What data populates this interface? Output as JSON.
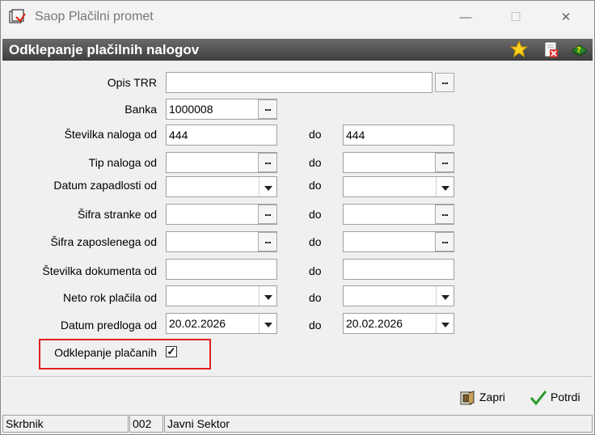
{
  "window": {
    "title": "Saop Plačilni promet",
    "minimize": "—",
    "maximize": "☐",
    "close": "✕"
  },
  "header": {
    "title": "Odklepanje plačilnih nalogov",
    "icons": [
      "star-icon",
      "delete-document-icon",
      "help-book-icon"
    ]
  },
  "form": {
    "opis_trr": {
      "label": "Opis TRR",
      "value": ""
    },
    "banka": {
      "label": "Banka",
      "value": "1000008"
    },
    "stevilka_naloga": {
      "label": "Številka naloga od",
      "from": "444",
      "to_label": "do",
      "to": "444"
    },
    "tip_naloga": {
      "label": "Tip naloga od",
      "from": "",
      "to_label": "do",
      "to": ""
    },
    "datum_zapadlosti": {
      "label": "Datum zapadlosti od",
      "from": "",
      "to_label": "do",
      "to": ""
    },
    "sifra_stranke": {
      "label": "Šifra stranke od",
      "from": "",
      "to_label": "do",
      "to": ""
    },
    "sifra_zaposlenega": {
      "label": "Šifra zaposlenega od",
      "from": "",
      "to_label": "do",
      "to": ""
    },
    "stevilka_dokumenta": {
      "label": "Številka dokumenta od",
      "from": "",
      "to_label": "do",
      "to": ""
    },
    "neto_rok": {
      "label": "Neto rok plačila od",
      "from": "",
      "to_label": "do",
      "to": ""
    },
    "datum_predloga": {
      "label": "Datum predloga od",
      "from": "20.02.2026",
      "to_label": "do",
      "to": "20.02.2026"
    },
    "odklepanje_placanih": {
      "label": "Odklepanje plačanih",
      "checked": true,
      "mark": "✓"
    }
  },
  "buttons": {
    "zapri": "Zapri",
    "potrdi": "Potrdi",
    "dots": "..."
  },
  "status": {
    "user": "Skrbnik",
    "code": "002",
    "org": "Javni Sektor"
  },
  "colors": {
    "header_bg": "#4a4a4a",
    "highlight": "#e02020"
  }
}
